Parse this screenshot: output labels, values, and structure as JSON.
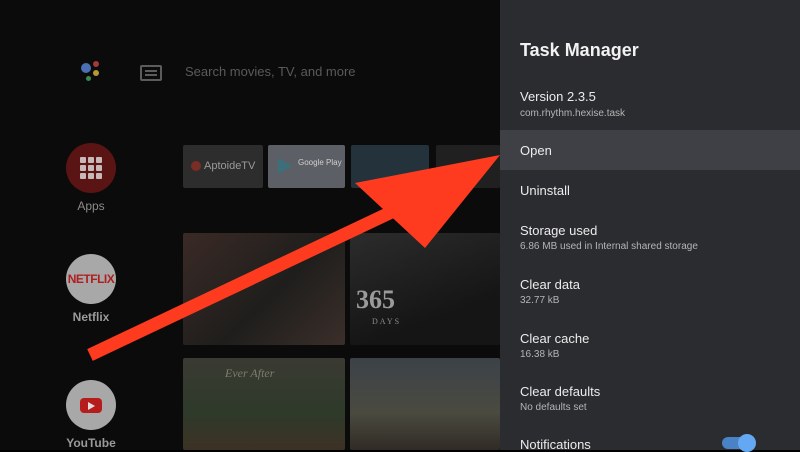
{
  "search": {
    "placeholder": "Search movies, TV, and more"
  },
  "side_apps": [
    {
      "label": "Apps",
      "icon": "apps-grid-icon"
    },
    {
      "label": "Netflix",
      "logo": "NETFLIX"
    },
    {
      "label": "YouTube",
      "icon": "youtube-play-icon"
    }
  ],
  "app_row": [
    {
      "label": "AptoideTV"
    },
    {
      "label": "Google Play"
    },
    {
      "label": ""
    }
  ],
  "movie_texts": {
    "big": "365",
    "small": "DAYS",
    "script": "Ever After"
  },
  "panel": {
    "title": "Task Manager",
    "items": [
      {
        "main": "Version 2.3.5",
        "sub": "com.rhythm.hexise.task",
        "focused": false
      },
      {
        "main": "Open",
        "sub": "",
        "focused": true
      },
      {
        "main": "Uninstall",
        "sub": "",
        "focused": false
      },
      {
        "main": "Storage used",
        "sub": "6.86 MB used in Internal shared storage",
        "focused": false
      },
      {
        "main": "Clear data",
        "sub": "32.77 kB",
        "focused": false
      },
      {
        "main": "Clear cache",
        "sub": "16.38 kB",
        "focused": false
      },
      {
        "main": "Clear defaults",
        "sub": "No defaults set",
        "focused": false
      },
      {
        "main": "Notifications",
        "sub": "",
        "focused": false,
        "toggle_on": true
      }
    ]
  },
  "colors": {
    "arrow": "#ff3b1f",
    "panel_bg": "#2b2c30",
    "focus_bg": "#3f4045",
    "toggle": "#64a8f3"
  }
}
